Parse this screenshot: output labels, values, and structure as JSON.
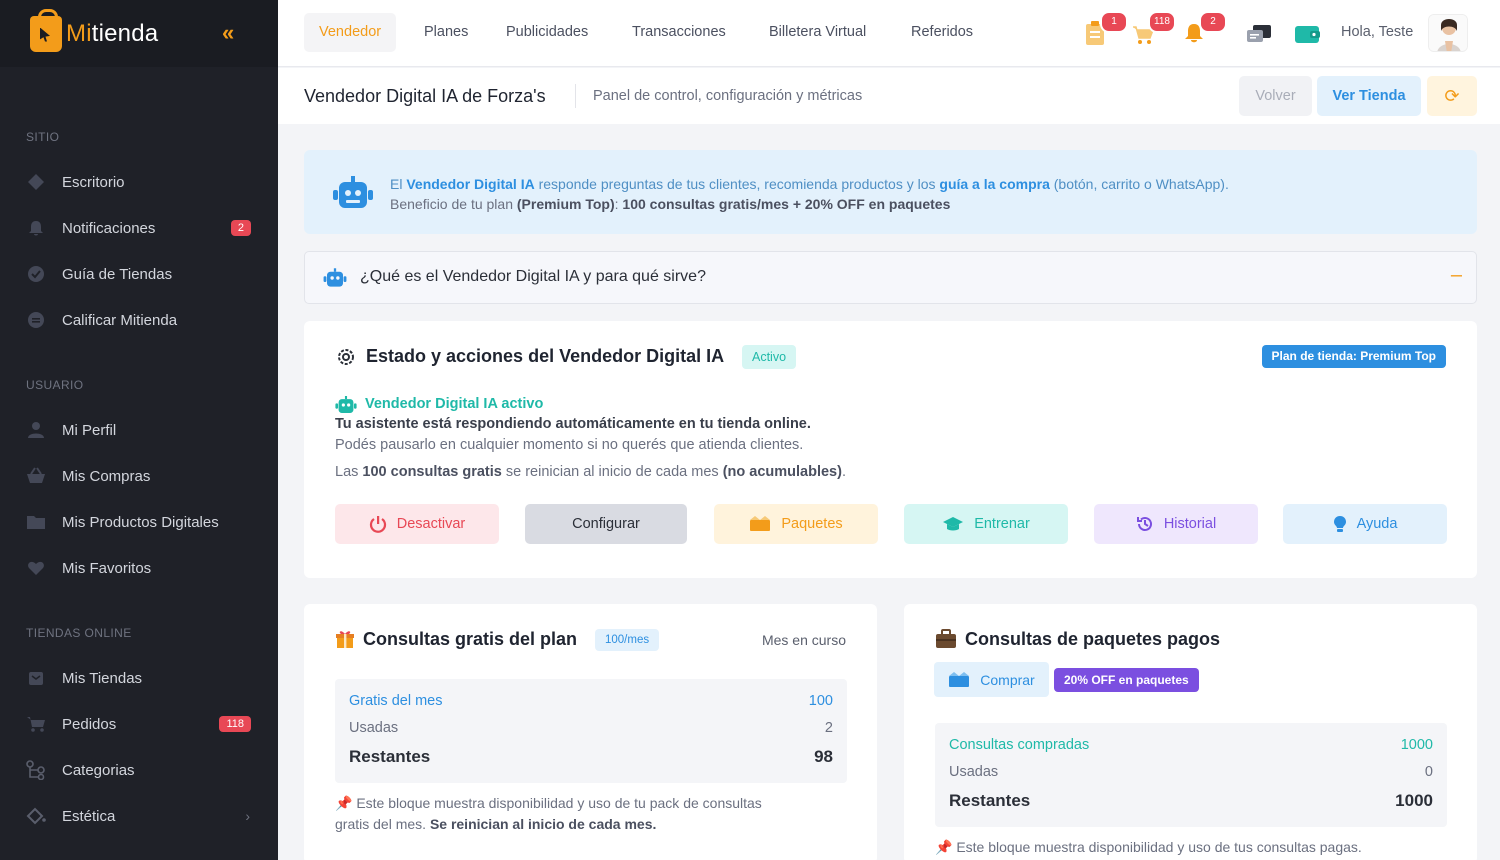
{
  "sidebar": {
    "brand_prefix": "Mi",
    "brand_suffix": "tienda",
    "collapse_icon": "double-chevron-left",
    "sections": [
      {
        "title": "SITIO",
        "items": [
          {
            "label": "Escritorio",
            "icon": "diamond-icon"
          },
          {
            "label": "Notificaciones",
            "icon": "bell-icon",
            "badge": "2"
          },
          {
            "label": "Guía de Tiendas",
            "icon": "badge-icon"
          },
          {
            "label": "Calificar Mitienda",
            "icon": "chat-icon"
          }
        ]
      },
      {
        "title": "USUARIO",
        "items": [
          {
            "label": "Mi Perfil",
            "icon": "user-icon"
          },
          {
            "label": "Mis Compras",
            "icon": "basket-icon"
          },
          {
            "label": "Mis Productos Digitales",
            "icon": "folder-icon"
          },
          {
            "label": "Mis Favoritos",
            "icon": "heart-icon"
          }
        ]
      },
      {
        "title": "TIENDAS ONLINE",
        "items": [
          {
            "label": "Mis Tiendas",
            "icon": "store-icon"
          },
          {
            "label": "Pedidos",
            "icon": "cart-icon",
            "badge": "118"
          },
          {
            "label": "Categorias",
            "icon": "tree-icon"
          },
          {
            "label": "Estética",
            "icon": "paint-icon",
            "chevron": "›"
          }
        ]
      }
    ]
  },
  "topnav": {
    "tabs": [
      "Vendedor",
      "Planes",
      "Publicidades",
      "Transacciones",
      "Billetera Virtual",
      "Referidos"
    ],
    "active_tab": "Vendedor",
    "badges": {
      "orders": "1",
      "cart": "118",
      "notifications": "2"
    },
    "greeting": "Hola, Teste"
  },
  "subheader": {
    "title": "Vendedor Digital IA de Forza's",
    "subtitle": "Panel de control, configuración y métricas",
    "back_label": "Volver",
    "view_store_label": "Ver Tienda"
  },
  "banner": {
    "l1_a": "El ",
    "l1_b": "Vendedor Digital IA",
    "l1_c": " responde preguntas de tus clientes, recomienda productos y los ",
    "l1_d": "guía a la compra",
    "l1_e": " (botón, carrito o WhatsApp).",
    "l2_a": "Beneficio de tu plan ",
    "l2_b": "(Premium Top)",
    "l2_c": ": ",
    "l2_d": "100 consultas gratis/mes + 20% OFF en paquetes"
  },
  "accordion": {
    "title": "¿Qué es el Vendedor Digital IA y para qué sirve?"
  },
  "status_card": {
    "title": "Estado y acciones del Vendedor Digital IA",
    "status_pill": "Activo",
    "plan_pill": "Plan de tienda: Premium Top",
    "active_label": "Vendedor Digital IA activo",
    "line1": "Tu asistente está respondiendo automáticamente en tu tienda online.",
    "line2": "Podés pausarlo en cualquier momento si no querés que atienda clientes.",
    "line3_a": "Las ",
    "line3_b": "100 consultas gratis",
    "line3_c": " se reinician al inicio de cada mes ",
    "line3_d": "(no acumulables)",
    "line3_e": ".",
    "actions": [
      {
        "label": "Desactivar",
        "icon": "power-icon",
        "bg": "#fde7ea",
        "fg": "#e84855"
      },
      {
        "label": "Configurar",
        "icon": "",
        "bg": "#d9dbe2",
        "fg": "#2b2f38"
      },
      {
        "label": "Paquetes",
        "icon": "boxes-icon",
        "bg": "#fff3dc",
        "fg": "#f39c1a"
      },
      {
        "label": "Entrenar",
        "icon": "graduation-cap-icon",
        "bg": "#d6f6f3",
        "fg": "#1fb9a8"
      },
      {
        "label": "Historial",
        "icon": "history-icon",
        "bg": "#efe7fd",
        "fg": "#7b4fe0"
      },
      {
        "label": "Ayuda",
        "icon": "lightbulb-icon",
        "bg": "#e3f1fc",
        "fg": "#2d8fe0"
      }
    ]
  },
  "free_card": {
    "title": "Consultas gratis del plan",
    "pill": "100/mes",
    "right_label": "Mes en curso",
    "rows": [
      {
        "label": "Gratis del mes",
        "value": "100"
      },
      {
        "label": "Usadas",
        "value": "2"
      },
      {
        "label": "Restantes",
        "value": "98"
      }
    ],
    "note_a": "Este bloque muestra disponibilidad y uso de tu pack de consultas",
    "note_b": "gratis del mes. ",
    "note_c": "Se reinician al inicio de cada mes."
  },
  "paid_card": {
    "title": "Consultas de paquetes pagos",
    "buy_label": "Comprar",
    "discount_pill": "20% OFF en paquetes",
    "rows": [
      {
        "label": "Consultas compradas",
        "value": "1000"
      },
      {
        "label": "Usadas",
        "value": "0"
      },
      {
        "label": "Restantes",
        "value": "1000"
      }
    ],
    "note": "Este bloque muestra disponibilidad y uso de tus consultas pagas."
  }
}
